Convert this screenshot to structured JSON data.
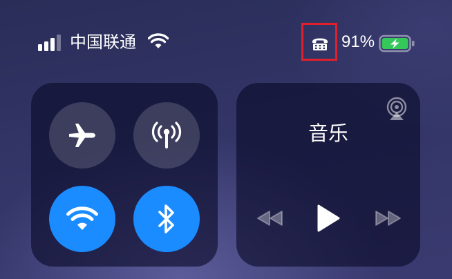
{
  "status_bar": {
    "carrier": "中国联通",
    "battery_percent": "91%",
    "signal_bars_active": 4,
    "icons": [
      "signal-icon",
      "wifi-icon",
      "tty-icon",
      "battery-icon",
      "charging-bolt-icon"
    ],
    "highlight_color": "#e0202a"
  },
  "connectivity": {
    "toggles": [
      {
        "name": "airplane-mode",
        "icon": "airplane-icon",
        "state": "off"
      },
      {
        "name": "cellular-data",
        "icon": "cellular-antenna-icon",
        "state": "off"
      },
      {
        "name": "wifi",
        "icon": "wifi-icon",
        "state": "on"
      },
      {
        "name": "bluetooth",
        "icon": "bluetooth-icon",
        "state": "on"
      }
    ],
    "active_color": "#1a8cff"
  },
  "music": {
    "title": "音乐",
    "icons": [
      "airplay-icon",
      "previous-track-icon",
      "play-icon",
      "next-track-icon"
    ]
  },
  "colors": {
    "battery_fill": "#34c759"
  }
}
